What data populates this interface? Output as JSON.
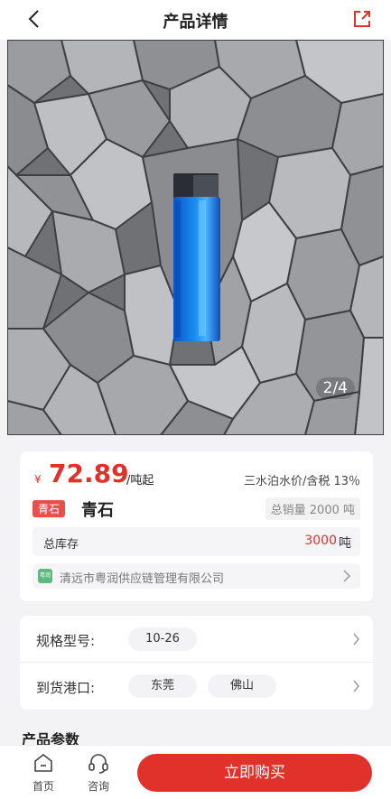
{
  "header": {
    "title": "产品详情"
  },
  "gallery": {
    "counter": "2/4"
  },
  "product": {
    "currency_symbol": "¥",
    "price": "72.89",
    "price_unit": "/吨起",
    "tax_info": "三水泊水价/含税 13％",
    "category_tag": "青石",
    "name": "青石",
    "total_sales": "总销量 2000 吨",
    "stock_label": "总库存",
    "stock_value": "3000",
    "stock_unit": "吨",
    "supplier_logo_text": "粤润",
    "supplier_name": "清远市粤润供应链管理有限公司"
  },
  "specs": {
    "model_label": "规格型号:",
    "model_options": [
      "10-26"
    ],
    "port_label": "到货港口:",
    "port_options": [
      "东莞",
      "佛山"
    ]
  },
  "sections": {
    "params_title": "产品参数"
  },
  "bottom_bar": {
    "home_label": "首页",
    "consult_label": "咨询",
    "buy_label": "立即购买"
  },
  "colors": {
    "accent": "#e0322b",
    "tag": "#e8514b",
    "lighter": "#1a8cf0"
  },
  "icons": [
    "back-icon",
    "share-icon",
    "chevron-right-icon",
    "home-icon",
    "headset-icon"
  ]
}
